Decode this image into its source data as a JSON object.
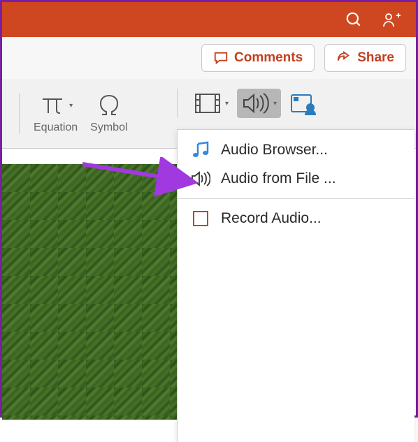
{
  "titlebar": {
    "search_icon": "search",
    "share_icon": "people-share"
  },
  "topbuttons": {
    "comments": "Comments",
    "share": "Share"
  },
  "ribbon": {
    "equation_label": "Equation",
    "symbol_label": "Symbol"
  },
  "media": {
    "video_icon": "video",
    "audio_icon": "audio",
    "cameo_icon": "cameo"
  },
  "dropdown": {
    "audio_browser": "Audio Browser...",
    "audio_from_file": "Audio from File ...",
    "record_audio": "Record Audio..."
  },
  "colors": {
    "brand": "#cf4720",
    "accent_purple": "#a139e0",
    "music_blue": "#2f8ae0"
  }
}
